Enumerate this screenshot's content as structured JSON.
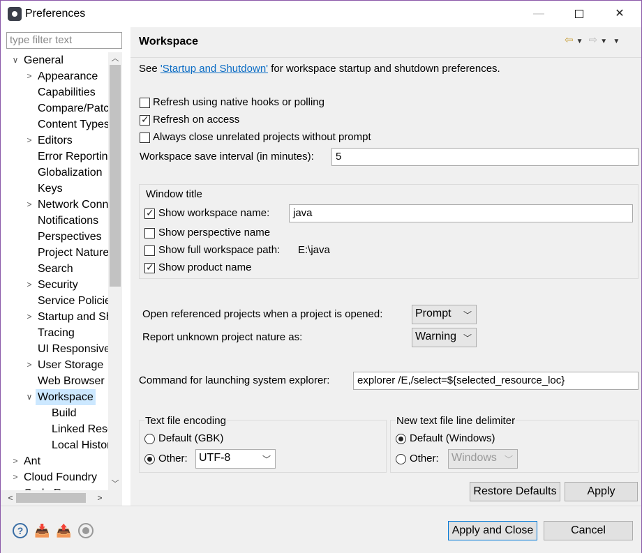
{
  "window": {
    "title": "Preferences"
  },
  "filter": {
    "placeholder": "type filter text"
  },
  "tree": {
    "items": [
      {
        "label": "General",
        "level": 0,
        "expander": "open"
      },
      {
        "label": "Appearance",
        "level": 1,
        "expander": "closed"
      },
      {
        "label": "Capabilities",
        "level": 1,
        "expander": "none"
      },
      {
        "label": "Compare/Patch",
        "level": 1,
        "expander": "none"
      },
      {
        "label": "Content Types",
        "level": 1,
        "expander": "none"
      },
      {
        "label": "Editors",
        "level": 1,
        "expander": "closed"
      },
      {
        "label": "Error Reporting",
        "level": 1,
        "expander": "none"
      },
      {
        "label": "Globalization",
        "level": 1,
        "expander": "none"
      },
      {
        "label": "Keys",
        "level": 1,
        "expander": "none"
      },
      {
        "label": "Network Connections",
        "level": 1,
        "expander": "closed"
      },
      {
        "label": "Notifications",
        "level": 1,
        "expander": "none"
      },
      {
        "label": "Perspectives",
        "level": 1,
        "expander": "none"
      },
      {
        "label": "Project Natures",
        "level": 1,
        "expander": "none"
      },
      {
        "label": "Search",
        "level": 1,
        "expander": "none"
      },
      {
        "label": "Security",
        "level": 1,
        "expander": "closed"
      },
      {
        "label": "Service Policies",
        "level": 1,
        "expander": "none"
      },
      {
        "label": "Startup and Shutdown",
        "level": 1,
        "expander": "closed"
      },
      {
        "label": "Tracing",
        "level": 1,
        "expander": "none"
      },
      {
        "label": "UI Responsiveness",
        "level": 1,
        "expander": "none"
      },
      {
        "label": "User Storage",
        "level": 1,
        "expander": "closed"
      },
      {
        "label": "Web Browser",
        "level": 1,
        "expander": "none"
      },
      {
        "label": "Workspace",
        "level": 1,
        "expander": "open",
        "selected": true
      },
      {
        "label": "Build",
        "level": 2,
        "expander": "none"
      },
      {
        "label": "Linked Resources",
        "level": 2,
        "expander": "none"
      },
      {
        "label": "Local History",
        "level": 2,
        "expander": "none"
      },
      {
        "label": "Ant",
        "level": 0,
        "expander": "closed"
      },
      {
        "label": "Cloud Foundry",
        "level": 0,
        "expander": "closed"
      },
      {
        "label": "Code Recommenders",
        "level": 0,
        "expander": "closed"
      }
    ]
  },
  "page": {
    "title": "Workspace",
    "intro_pre": "See ",
    "intro_link": "'Startup and Shutdown'",
    "intro_post": " for workspace startup and shutdown preferences.",
    "refresh_native": {
      "label": "Refresh using native hooks or polling",
      "checked": false
    },
    "refresh_access": {
      "label": "Refresh on access",
      "checked": true
    },
    "always_close": {
      "label": "Always close unrelated projects without prompt",
      "checked": false
    },
    "save_interval": {
      "label": "Workspace save interval (in minutes):",
      "value": "5"
    },
    "window_title": {
      "group_label": "Window title",
      "show_ws_name": {
        "label": "Show workspace name:",
        "checked": true,
        "value": "java"
      },
      "show_perspective": {
        "label": "Show perspective name",
        "checked": false
      },
      "show_full_path": {
        "label": "Show full workspace path:",
        "checked": false,
        "value": "E:\\java"
      },
      "show_product": {
        "label": "Show product name",
        "checked": true
      }
    },
    "open_ref": {
      "label": "Open referenced projects when a project is opened:",
      "value": "Prompt"
    },
    "unknown_nature": {
      "label": "Report unknown project nature as:",
      "value": "Warning"
    },
    "explorer_cmd": {
      "label": "Command for launching system explorer:",
      "value": "explorer /E,/select=${selected_resource_loc}"
    },
    "encoding": {
      "group_label": "Text file encoding",
      "default_label": "Default (GBK)",
      "other_label": "Other:",
      "other_value": "UTF-8",
      "selected": "other"
    },
    "delimiter": {
      "group_label": "New text file line delimiter",
      "default_label": "Default (Windows)",
      "other_label": "Other:",
      "other_value": "Windows",
      "selected": "default"
    },
    "restore_defaults": "Restore Defaults",
    "apply": "Apply"
  },
  "footer": {
    "apply_close": "Apply and Close",
    "cancel": "Cancel",
    "icons": [
      "help-icon",
      "import-icon",
      "export-icon",
      "record-icon"
    ]
  }
}
